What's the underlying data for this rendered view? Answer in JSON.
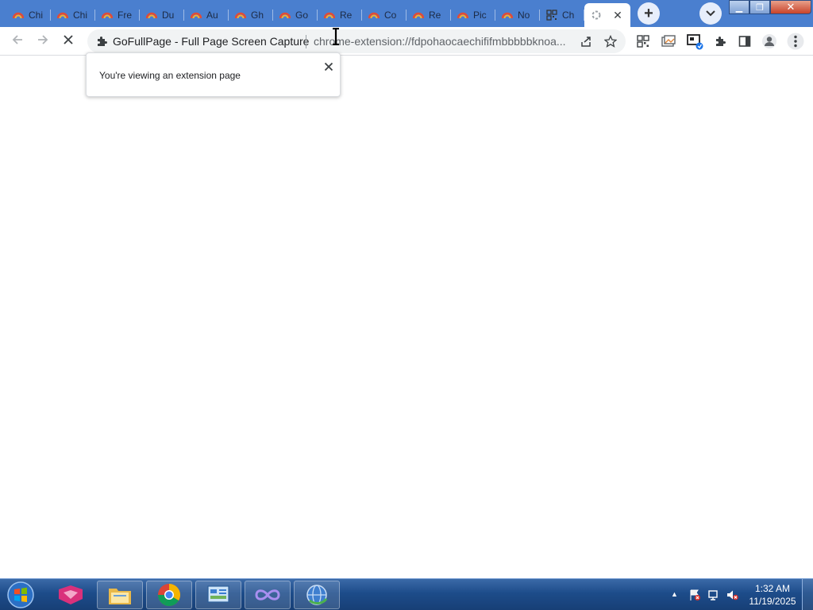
{
  "tabs": [
    {
      "label": "Chi",
      "favicon": "chromium-icon"
    },
    {
      "label": "Chi",
      "favicon": "chromium-icon"
    },
    {
      "label": "Fre",
      "favicon": "chromium-icon"
    },
    {
      "label": "Du",
      "favicon": "chromium-icon"
    },
    {
      "label": "Au",
      "favicon": "chromium-icon"
    },
    {
      "label": "Gh",
      "favicon": "chromium-icon"
    },
    {
      "label": "Go",
      "favicon": "chromium-icon"
    },
    {
      "label": "Re",
      "favicon": "chromium-icon"
    },
    {
      "label": "Co",
      "favicon": "chromium-icon"
    },
    {
      "label": "Re",
      "favicon": "chromium-icon"
    },
    {
      "label": "Pic",
      "favicon": "chromium-icon"
    },
    {
      "label": "No",
      "favicon": "chromium-icon"
    },
    {
      "label": "Ch",
      "favicon": "qr-code-icon"
    }
  ],
  "active_tab": {
    "close_glyph": "✕",
    "favicon": "loading-spinner-icon"
  },
  "newtab_glyph": "+",
  "window_controls": {
    "minimize": "▁",
    "maximize": "❐",
    "close": "✕"
  },
  "omnibox": {
    "extension_name": "GoFullPage - Full Page Screen Capture",
    "url": "chrome-extension://fdpohaocaechififmbbbbbknoa..."
  },
  "popup": {
    "message": "You're viewing an extension page",
    "close_glyph": "✕"
  },
  "taskbar": {
    "apps": [
      "start-orb",
      "gitkraken-icon",
      "file-explorer-icon",
      "chrome-icon",
      "control-panel-icon",
      "visual-studio-icon",
      "network-globe-icon"
    ]
  },
  "clock": {
    "time": "1:32 AM",
    "date": "11/19/2025"
  },
  "tray_arrow": "▲",
  "colors": {
    "tabstrip": "#4a7fcf",
    "taskbar": "#1d4c8a",
    "accent": "#1a73e8"
  }
}
